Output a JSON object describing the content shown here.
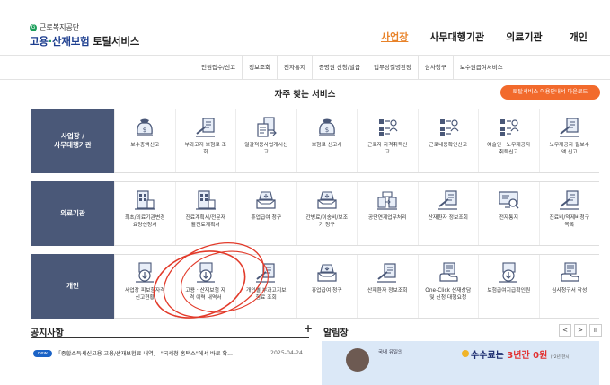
{
  "header": {
    "org_name": "근로복지공단",
    "logo_mark": "G",
    "title_part1": "고용",
    "title_sep": "·",
    "title_part2": "산재보험",
    "title_part3": " 토탈서비스"
  },
  "top_nav": [
    "사업장",
    "사무대행기관",
    "의료기관",
    "개인"
  ],
  "sub_nav": [
    "인원접수/신고",
    "정보조회",
    "전자통지",
    "증명원 신청/발급",
    "업무상질병판정",
    "심사청구",
    "보수원급여서비스"
  ],
  "section_title": "자주 찾는 서비스",
  "download_button": "토탈서비스 이용안내서 다운로드",
  "rows": [
    {
      "label": "사업장 /\n사무대행기관",
      "items": [
        {
          "label": "보수총액신고",
          "icon": "money-bag-icon"
        },
        {
          "label": "부과고지 보험료 조\n회",
          "icon": "document-pen-icon"
        },
        {
          "label": "일괄적용사업개시신\n고",
          "icon": "document-transfer-icon"
        },
        {
          "label": "보험료 신고서",
          "icon": "money-bag-icon"
        },
        {
          "label": "근로자 자격취득신\n고",
          "icon": "person-list-icon"
        },
        {
          "label": "근로내용확인신고",
          "icon": "person-list-icon"
        },
        {
          "label": "예술인 · 노무제공자\n취득신고",
          "icon": "person-list-icon"
        },
        {
          "label": "노무제공자 월보수\n액 신고",
          "icon": "document-pen-icon"
        }
      ]
    },
    {
      "label": "의료기관",
      "items": [
        {
          "label": "최초/의료기관변경\n요양신청서",
          "icon": "building-icon"
        },
        {
          "label": "진료계획서/전문재\n활진료계획서",
          "icon": "building-icon"
        },
        {
          "label": "휴업급여 청구",
          "icon": "inbox-icon"
        },
        {
          "label": "간병료/이송비/보조\n기 청구",
          "icon": "inbox-icon"
        },
        {
          "label": "공단연계업무처리",
          "icon": "exchange-icon"
        },
        {
          "label": "산재환자 정보조회",
          "icon": "document-pen-icon"
        },
        {
          "label": "전자통지",
          "icon": "monitor-search-icon"
        },
        {
          "label": "진료비/약제비청구\n목록",
          "icon": "document-pen-icon"
        }
      ]
    },
    {
      "label": "개인",
      "items": [
        {
          "label": "사업장 피보험자격\n신고현황",
          "icon": "document-download-icon"
        },
        {
          "label": "고용 · 산재보험 자\n격 이력 내역서",
          "icon": "document-download-icon"
        },
        {
          "label": "개인별 부과고지보\n험료 조회",
          "icon": "document-pen-icon"
        },
        {
          "label": "휴업급여 청구",
          "icon": "inbox-icon"
        },
        {
          "label": "산재환자 정보조회",
          "icon": "document-pen-icon"
        },
        {
          "label": "One-Click 산재상담\n및 신청 대행요청",
          "icon": "hand-document-icon"
        },
        {
          "label": "보험급여지급확인원",
          "icon": "document-download-icon"
        },
        {
          "label": "심사청구서 작성",
          "icon": "hand-document-icon"
        }
      ]
    }
  ],
  "notice": {
    "title": "공지사항",
    "plus": "+",
    "badge": "new",
    "text": "「종합소득세신고용 고용/산재보험료 내역」 \"국세청 홈택스\"에서 바로 확...",
    "date": "2025-04-24"
  },
  "alarm": {
    "title": "알림창",
    "prev": "<",
    "next": ">",
    "pause": "II"
  },
  "banner": {
    "small_text": "국내 유일의",
    "headline_a": "수수료는 ",
    "headline_b": "3년간 ",
    "headline_c": "0원",
    "headline_note": "(*2년 한시)"
  }
}
